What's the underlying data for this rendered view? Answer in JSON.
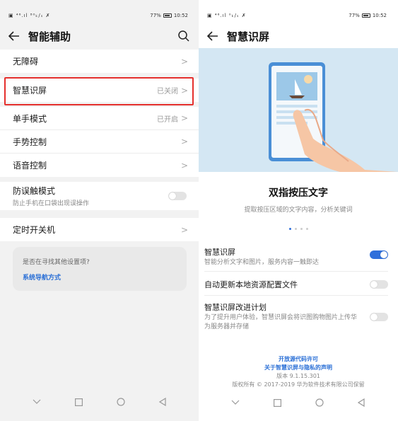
{
  "left": {
    "status": {
      "left": "▣ ⁴⁶.ıl ⁸⁰ₖ/ₛ ✗",
      "battery_pct": "77%",
      "time": "10:52"
    },
    "title": "智能辅助",
    "items": [
      {
        "label": "无障碍"
      },
      {
        "label": "智慧识屏",
        "value": "已关闭"
      },
      {
        "label": "单手模式",
        "value": "已开启"
      },
      {
        "label": "手势控制"
      },
      {
        "label": "语音控制"
      },
      {
        "label": "防误触模式",
        "sub": "防止手机在口袋出现误操作",
        "toggle": false
      },
      {
        "label": "定时开关机"
      }
    ],
    "suggest": {
      "question": "是否在寻找其他设置项?",
      "link": "系统导航方式"
    }
  },
  "right": {
    "status": {
      "left": "▣ ⁴⁶.ıl ⁰ₖ/ₛ ✗",
      "battery_pct": "77%",
      "time": "10:52"
    },
    "title": "智慧识屏",
    "hero_title": "双指按压文字",
    "hero_sub": "提取按压区域的文字内容，分析关键词",
    "pages": 4,
    "active_page": 0,
    "settings": [
      {
        "label": "智慧识屏",
        "sub": "智能分析文字和图片，服务内容一触即达",
        "toggle": true
      },
      {
        "label": "自动更新本地资源配置文件",
        "sub": "",
        "toggle": false
      },
      {
        "label": "智慧识屏改进计划",
        "sub": "为了提升用户体验，智慧识屏会将识图购物图片上传华为服务器并存储",
        "toggle": false
      }
    ],
    "footer": {
      "open_source": "开放源代码许可",
      "privacy": "关于智慧识屏与隐私的声明",
      "version": "版本 9.1.15.301",
      "copyright": "版权所有 © 2017-2019 华为软件技术有限公司保留"
    }
  },
  "colors": {
    "accent": "#2f6fdb",
    "highlight": "#e5302d",
    "link": "#2a6fd6"
  }
}
